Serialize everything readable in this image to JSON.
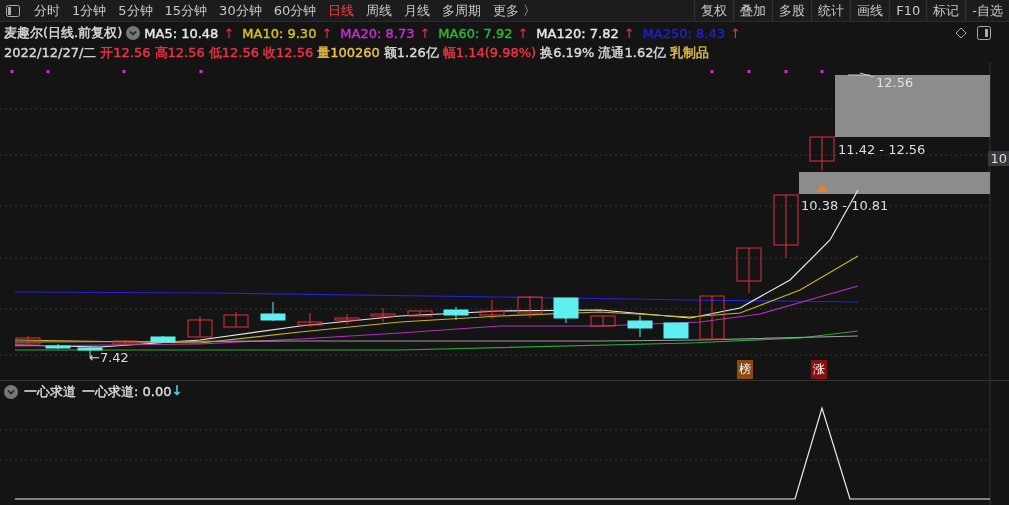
{
  "toolbar": {
    "periods": [
      {
        "label": "分时",
        "selected": false
      },
      {
        "label": "1分钟",
        "selected": false
      },
      {
        "label": "5分钟",
        "selected": false
      },
      {
        "label": "15分钟",
        "selected": false
      },
      {
        "label": "30分钟",
        "selected": false
      },
      {
        "label": "60分钟",
        "selected": false
      },
      {
        "label": "日线",
        "selected": true
      },
      {
        "label": "周线",
        "selected": false
      },
      {
        "label": "月线",
        "selected": false
      },
      {
        "label": "多周期",
        "selected": false
      }
    ],
    "more": "更多 〉",
    "tools": [
      "复权",
      "叠加",
      "多股",
      "统计",
      "画线",
      "F10",
      "标记",
      "-自选"
    ]
  },
  "info": {
    "title": "麦趣尔(日线.前复权)",
    "averages": [
      {
        "label": "MA5: 10.48",
        "arrow": "↑",
        "color": "#e8e8e8"
      },
      {
        "label": "MA10: 9.30",
        "arrow": "↑",
        "color": "#d4c21c"
      },
      {
        "label": "MA20: 8.73",
        "arrow": "↑",
        "color": "#c42fd0"
      },
      {
        "label": "MA60: 7.92",
        "arrow": "↑",
        "color": "#2fb53a"
      },
      {
        "label": "MA120: 7.82",
        "arrow": "↑",
        "color": "#e8e8e8"
      },
      {
        "label": "MA250: 8.43",
        "arrow": "↑",
        "color": "#2020d0"
      }
    ],
    "quote": [
      {
        "text": "2022/12/27/二",
        "color": "#d8d8d8"
      },
      {
        "text": "开12.56",
        "color": "#ee3344"
      },
      {
        "text": "高12.56",
        "color": "#ee3344"
      },
      {
        "text": "低12.56",
        "color": "#ee3344"
      },
      {
        "text": "收12.56",
        "color": "#ee3344"
      },
      {
        "text": "量100260",
        "color": "#e8c24a"
      },
      {
        "text": "额1.26亿",
        "color": "#d8d8d8"
      },
      {
        "text": "幅1.14(9.98%)",
        "color": "#ee3344"
      },
      {
        "text": "换6.19%",
        "color": "#d8d8d8"
      },
      {
        "text": "流通1.62亿",
        "color": "#d8d8d8"
      },
      {
        "text": "乳制品",
        "color": "#e8c24a"
      }
    ]
  },
  "chart": {
    "high_label": "12.56",
    "range_upper": "11.42 - 12.56",
    "range_lower": "10.38 - 10.81",
    "low_label": "←7.42",
    "axis_label": "10",
    "badges": [
      {
        "text": "榜",
        "color": "#8a4a14"
      },
      {
        "text": "涨",
        "color": "#8a1010"
      }
    ]
  },
  "indicator": {
    "name": "一心求道",
    "reading": "一心求道: 0.00",
    "arrow": "↓"
  }
}
